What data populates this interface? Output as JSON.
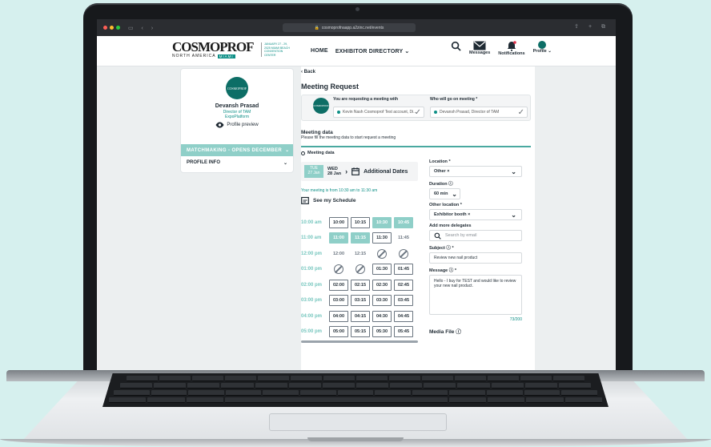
{
  "browser": {
    "url": "cosmoprofnaapp.a2zinc.net/events",
    "traffic_colors": [
      "#ff5f57",
      "#febc2e",
      "#28c840"
    ]
  },
  "brand": {
    "logo_word": "COSMOPROF",
    "logo_region": "NORTH AMERICA",
    "logo_tag": "MIAMI",
    "logo_date": "JANUARY 27 - 29, 2025 MIAMI BEACH CONVENTION CENTER",
    "accent": "#0d8f86"
  },
  "nav": {
    "home": "HOME",
    "exhibitor_directory": "EXHIBITOR DIRECTORY",
    "messages": "Messages",
    "notifications": "Notifications",
    "profile": "Profile"
  },
  "left_card": {
    "avatar_text": "COSMOPROF",
    "name": "Devansh Prasad",
    "role_line1": "Director of TAM",
    "role_line2": "ExpoPlatform",
    "profile_preview": "Profile preview",
    "matchmaking": "MATCHMAKING - OPENS DECEMBER",
    "profile_info": "PROFILE INFO"
  },
  "meeting": {
    "back": "Back",
    "title": "Meeting Request",
    "requesting_label": "You are requesting a meeting with",
    "requesting_value": "Kevin Nash Cosmoprof Test account, Di...",
    "who_label": "Who will go on meeting *",
    "who_value": "Devansh Prasad, Director of TAM",
    "data_title": "Meeting data",
    "data_hint": "Please fill the meeting data to start request a meeting",
    "radio_label": "Meeting data",
    "tue_day": "TUE",
    "tue_date": "27 Jan",
    "wed_day": "WED",
    "wed_date": "28 Jan",
    "additional_dates": "Additional Dates",
    "time_note": "Your meeting is from 10:30 am to 11:30 am",
    "see_schedule": "See my Schedule"
  },
  "schedule": [
    {
      "hour": "10:00 am",
      "slots": [
        {
          "t": "10:00",
          "s": "box"
        },
        {
          "t": "10:15",
          "s": "box"
        },
        {
          "t": "10:30",
          "s": "sel"
        },
        {
          "t": "10:45",
          "s": "sel"
        }
      ]
    },
    {
      "hour": "11:00 am",
      "slots": [
        {
          "t": "11:00",
          "s": "sel"
        },
        {
          "t": "11:15",
          "s": "sel"
        },
        {
          "t": "11:30",
          "s": "box"
        },
        {
          "t": "11:45",
          "s": "plain"
        }
      ]
    },
    {
      "hour": "12:00 pm",
      "slots": [
        {
          "t": "12:00",
          "s": "plain"
        },
        {
          "t": "12:15",
          "s": "plain"
        },
        {
          "t": "",
          "s": "na"
        },
        {
          "t": "",
          "s": "na"
        }
      ]
    },
    {
      "hour": "01:00 pm",
      "slots": [
        {
          "t": "",
          "s": "na"
        },
        {
          "t": "",
          "s": "na"
        },
        {
          "t": "01:30",
          "s": "box"
        },
        {
          "t": "01:45",
          "s": "box"
        }
      ]
    },
    {
      "hour": "02:00 pm",
      "slots": [
        {
          "t": "02:00",
          "s": "box"
        },
        {
          "t": "02:15",
          "s": "box"
        },
        {
          "t": "02:30",
          "s": "box"
        },
        {
          "t": "02:45",
          "s": "box"
        }
      ]
    },
    {
      "hour": "03:00 pm",
      "slots": [
        {
          "t": "03:00",
          "s": "box"
        },
        {
          "t": "03:15",
          "s": "box"
        },
        {
          "t": "03:30",
          "s": "box"
        },
        {
          "t": "03:45",
          "s": "box"
        }
      ]
    },
    {
      "hour": "04:00 pm",
      "slots": [
        {
          "t": "04:00",
          "s": "box"
        },
        {
          "t": "04:15",
          "s": "box"
        },
        {
          "t": "04:30",
          "s": "box"
        },
        {
          "t": "04:45",
          "s": "box"
        }
      ]
    },
    {
      "hour": "05:00 pm",
      "slots": [
        {
          "t": "05:00",
          "s": "box"
        },
        {
          "t": "05:15",
          "s": "box"
        },
        {
          "t": "05:30",
          "s": "box"
        },
        {
          "t": "05:45",
          "s": "box"
        }
      ]
    }
  ],
  "form": {
    "location_label": "Location *",
    "location_value": "Other ×",
    "duration_label": "Duration",
    "duration_value": "60 min",
    "other_location_label": "Other location *",
    "other_location_value": "Exhibitor booth ×",
    "delegates_label": "Add more delegates",
    "delegates_placeholder": "Search by email",
    "subject_label": "Subject",
    "subject_value": "Review new nail product",
    "message_label": "Message",
    "message_value": "Hello - I buy for TEST and would like to review your new nail product.",
    "char_count": "73/200",
    "media_file": "Media File"
  }
}
